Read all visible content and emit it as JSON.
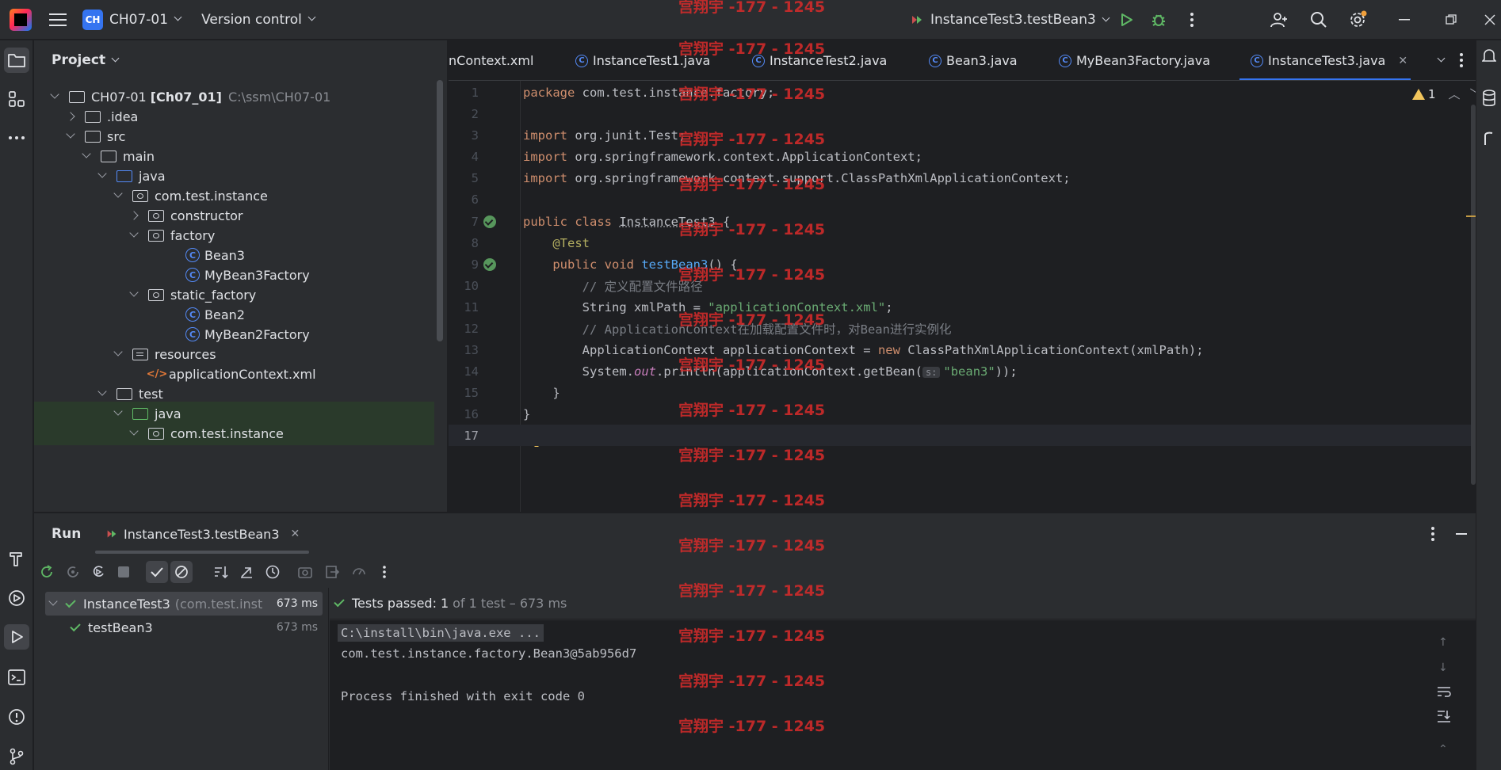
{
  "titlebar": {
    "project_badge": "CH",
    "project_name": "CH07-01",
    "vcs": "Version control",
    "run_config": "InstanceTest3.testBean3"
  },
  "project_panel": {
    "title": "Project",
    "root_name": "CH07-01",
    "root_module": "[Ch07_01]",
    "root_path": "C:\\ssm\\CH07-01",
    "items": [
      {
        "label": ".idea"
      },
      {
        "label": "src"
      },
      {
        "label": "main"
      },
      {
        "label": "java"
      },
      {
        "label": "com.test.instance"
      },
      {
        "label": "constructor"
      },
      {
        "label": "factory"
      },
      {
        "label": "Bean3"
      },
      {
        "label": "MyBean3Factory"
      },
      {
        "label": "static_factory"
      },
      {
        "label": "Bean2"
      },
      {
        "label": "MyBean2Factory"
      },
      {
        "label": "resources"
      },
      {
        "label": "applicationContext.xml"
      },
      {
        "label": "test"
      },
      {
        "label": "java"
      },
      {
        "label": "com.test.instance"
      }
    ]
  },
  "editor": {
    "tabs": [
      {
        "label": "nContext.xml"
      },
      {
        "label": "InstanceTest1.java"
      },
      {
        "label": "InstanceTest2.java"
      },
      {
        "label": "Bean3.java"
      },
      {
        "label": "MyBean3Factory.java"
      },
      {
        "label": "InstanceTest3.java"
      }
    ],
    "warnings_count": "1",
    "line_numbers": [
      "1",
      "2",
      "3",
      "4",
      "5",
      "6",
      "7",
      "8",
      "9",
      "10",
      "11",
      "12",
      "13",
      "14",
      "15",
      "16",
      "17"
    ],
    "code": {
      "l1_kw": "package",
      "l1_rest": " com.test.instance.factory;",
      "l3_kw": "import",
      "l3_rest": " org.junit.Test;",
      "l4_kw": "import",
      "l4_rest": " org.springframework.context.ApplicationContext;",
      "l5_kw": "import",
      "l5_rest": " org.springframework.context.support.ClassPathXmlApplicationContext;",
      "l7_kw": "public class",
      "l7_name": "InstanceTest3",
      "l7_rest": " {",
      "l8_ann": "@Test",
      "l9_kw": "public void",
      "l9_fn": "testBean3",
      "l9_rest": "() {",
      "l10_cmt": "// 定义配置文件路径",
      "l11_a": "String xmlPath = ",
      "l11_str": "\"applicationContext.xml\"",
      "l11_b": ";",
      "l12_cmt": "// ApplicationContext在加载配置文件时，对Bean进行实例化",
      "l13_a": "ApplicationContext applicationContext = ",
      "l13_kw": "new",
      "l13_b": " ClassPathXmlApplicationContext(xmlPath);",
      "l14_a": "System.",
      "l14_out": "out",
      "l14_b": ".println(applicationContext.getBean(",
      "l14_hint": "s:",
      "l14_str": "\"bean3\"",
      "l14_c": "));",
      "l15": "}",
      "l16": "}"
    }
  },
  "run_panel": {
    "title": "Run",
    "tab_label": "InstanceTest3.testBean3",
    "tests": [
      {
        "name": "InstanceTest3",
        "detail": "(com.test.inst",
        "time": "673 ms"
      },
      {
        "name": "testBean3",
        "time": "673 ms"
      }
    ],
    "status_label": "Tests passed:",
    "status_count": "1",
    "status_rest": "of 1 test – 673 ms",
    "console": [
      "C:\\install\\bin\\java.exe ...",
      "com.test.instance.factory.Bean3@5ab956d7",
      "",
      "Process finished with exit code 0"
    ]
  },
  "watermark": "宫翔宇 -177 - 1245",
  "colors": {
    "accent": "#3574f0",
    "success": "#5fb865",
    "watermark": "#d92b2b"
  }
}
